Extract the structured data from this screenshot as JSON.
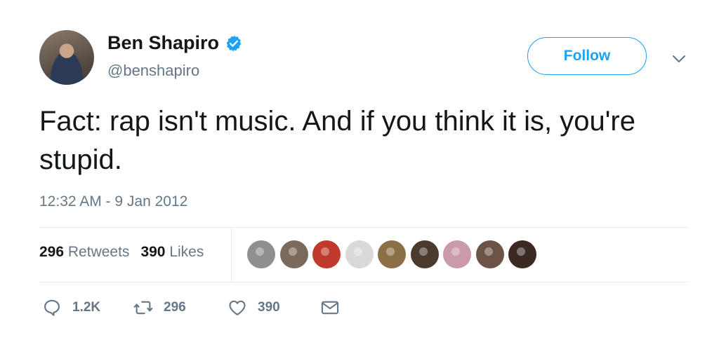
{
  "author": {
    "display_name": "Ben Shapiro",
    "handle": "@benshapiro",
    "verified": true
  },
  "follow_button_label": "Follow",
  "tweet": {
    "text": "Fact: rap isn't music. And if you think it is, you're stupid.",
    "timestamp": "12:32 AM - 9 Jan 2012"
  },
  "stats": {
    "retweets_count": "296",
    "retweets_label": "Retweets",
    "likes_count": "390",
    "likes_label": "Likes"
  },
  "likers_avatar_colors": [
    "#8f8f8f",
    "#7a6a5e",
    "#c0392b",
    "#d9d9d9",
    "#8b6f47",
    "#4a3b2e",
    "#c99aa8",
    "#6b5346",
    "#3b2a22"
  ],
  "actions": {
    "replies": "1.2K",
    "retweets": "296",
    "likes": "390"
  },
  "colors": {
    "accent": "#1da1f2",
    "secondary_text": "#657786",
    "primary_text": "#14171a"
  }
}
